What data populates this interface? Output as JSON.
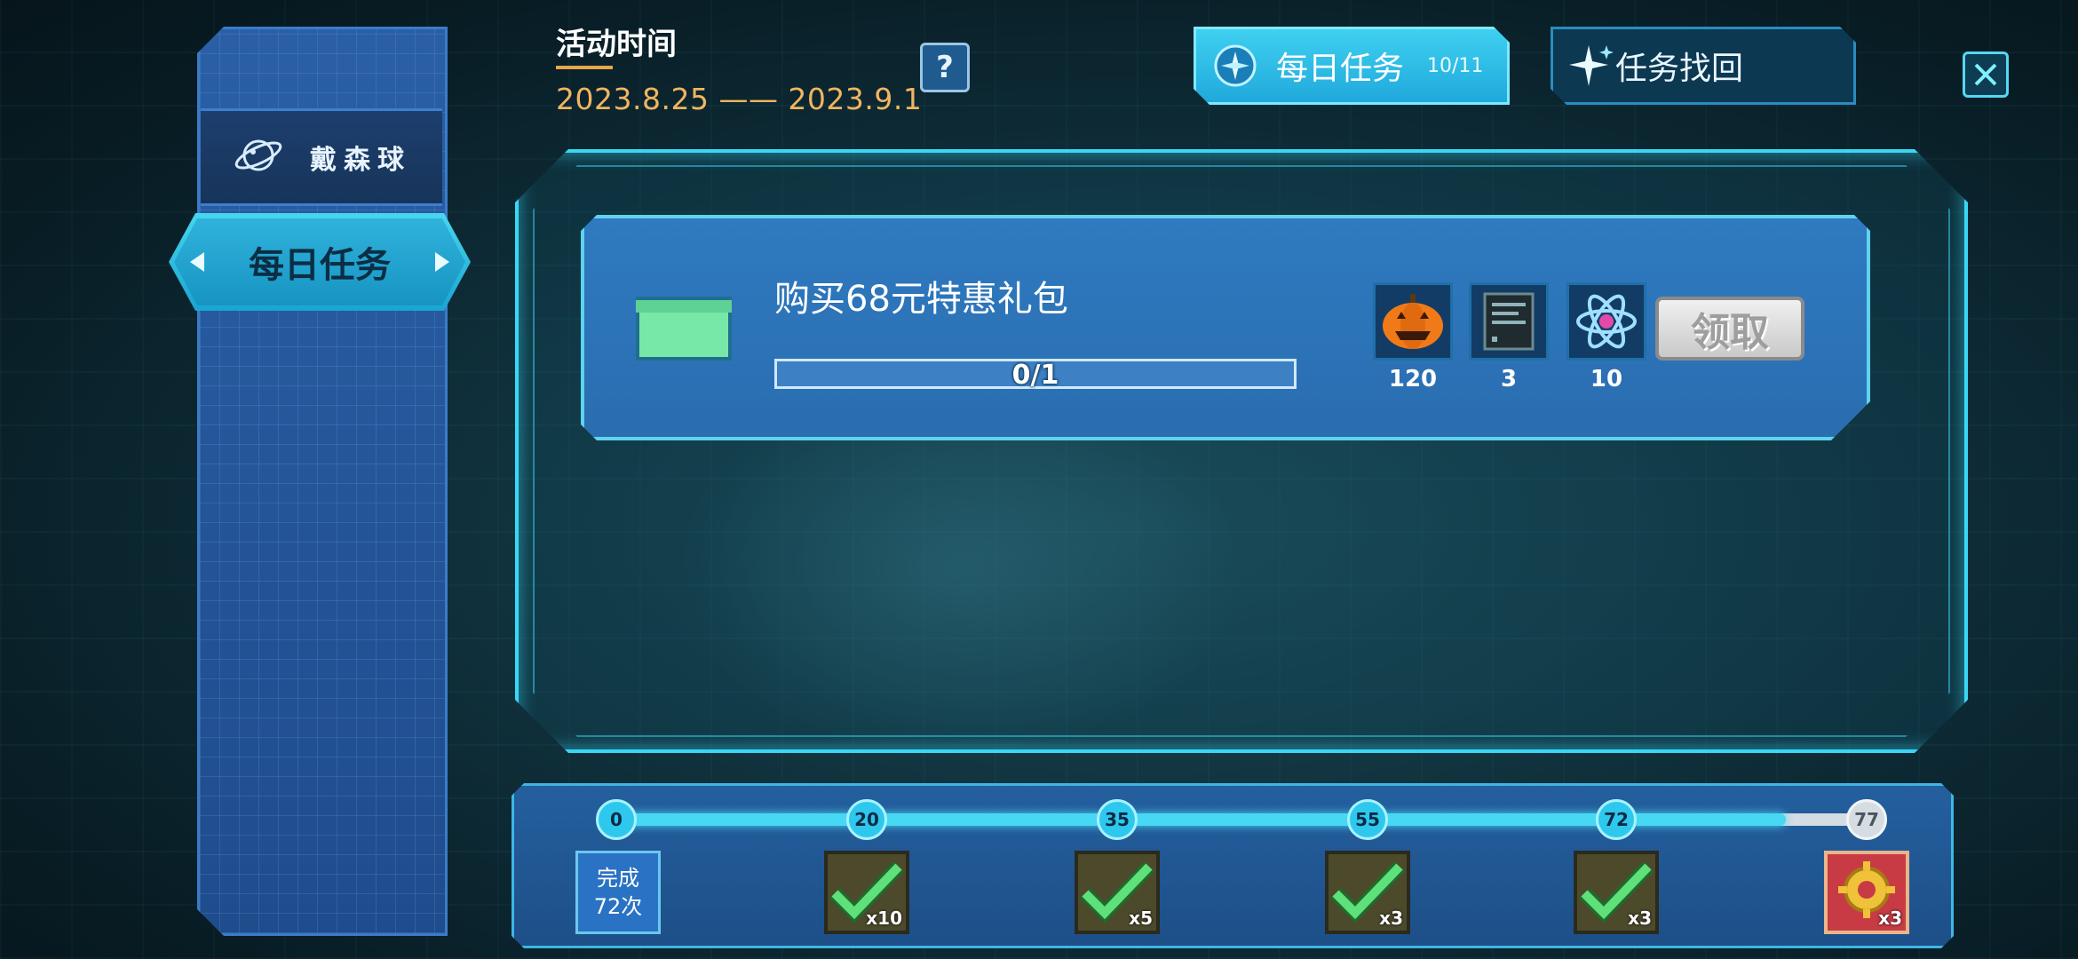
{
  "header": {
    "activity_label": "活动时间",
    "activity_dates": "2023.8.25 —— 2023.9.1",
    "help_label": "?",
    "tabs": [
      {
        "label": "每日任务",
        "count": "10/11"
      },
      {
        "label": "任务找回"
      }
    ]
  },
  "sidebar": {
    "items": [
      {
        "label": "戴森球"
      },
      {
        "label": "每日任务"
      }
    ]
  },
  "task": {
    "title": "购买68元特惠礼包",
    "progress_text": "0/1",
    "progress": 0,
    "rewards": [
      {
        "icon": "pumpkin-icon",
        "count": "120"
      },
      {
        "icon": "data-chip-icon",
        "count": "3"
      },
      {
        "icon": "atom-icon",
        "count": "10"
      }
    ],
    "claim_label": "领取"
  },
  "milestones": {
    "current": 72,
    "max": 77,
    "complete_line1": "完成",
    "complete_line2": "72次",
    "points": [
      {
        "label": "0"
      },
      {
        "label": "20",
        "qty": "x10",
        "claimed": true
      },
      {
        "label": "35",
        "qty": "x5",
        "claimed": true
      },
      {
        "label": "55",
        "qty": "x3",
        "claimed": true
      },
      {
        "label": "72",
        "qty": "x3",
        "claimed": true
      },
      {
        "label": "77",
        "qty": "x3",
        "claimed": false
      }
    ]
  },
  "colors": {
    "accent": "#39d7f5",
    "date_text": "#f0b561",
    "check": "#5fe07a"
  }
}
